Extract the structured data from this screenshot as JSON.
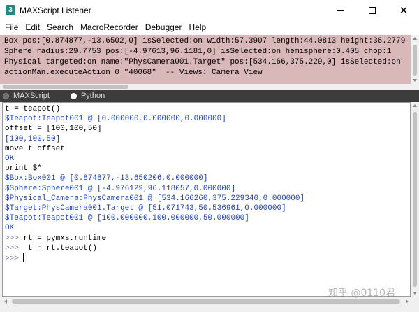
{
  "window": {
    "title": "MAXScript Listener",
    "icon_glyph": "3",
    "controls": {
      "minimize": "minimize-icon",
      "maximize": "maximize-icon",
      "close_glyph": "✕"
    }
  },
  "menu": [
    "File",
    "Edit",
    "Search",
    "MacroRecorder",
    "Debugger",
    "Help"
  ],
  "macro_recorder": {
    "lines": [
      "Box pos:[0.874877,-13.6502,0] isSelected:on width:57.3907 length:44.0813 height:36.2779",
      "Sphere radius:29.7753 pos:[-4.97613,96.1181,0] isSelected:on hemisphere:0.405 chop:1",
      "Physical targeted:on name:\"PhysCamera001.Target\" pos:[534.166,375.229,0] isSelected:on",
      "actionMan.executeAction 0 \"40068\"  -- Views: Camera View"
    ]
  },
  "tabs": [
    {
      "label": "MAXScript",
      "selected": false
    },
    {
      "label": "Python",
      "selected": true
    }
  ],
  "listener": {
    "colors": {
      "input": "#000000",
      "result": "#1a3fbf",
      "prompt": "#7a7ab0"
    },
    "lines": [
      {
        "kind": "input",
        "text": "t = teapot()"
      },
      {
        "kind": "result",
        "text": "$Teapot:Teapot001 @ [0.000000,0.000000,0.000000]"
      },
      {
        "kind": "input",
        "text": "offset = [100,100,50]"
      },
      {
        "kind": "result",
        "text": "[100,100,50]"
      },
      {
        "kind": "input",
        "text": "move t offset"
      },
      {
        "kind": "result",
        "text": "OK"
      },
      {
        "kind": "input",
        "text": "print $*"
      },
      {
        "kind": "result",
        "text": "$Box:Box001 @ [0.874877,-13.650206,0.000000]"
      },
      {
        "kind": "result",
        "text": "$Sphere:Sphere001 @ [-4.976129,96.118057,0.000000]"
      },
      {
        "kind": "result",
        "text": "$Physical_Camera:PhysCamera001 @ [534.166260,375.229340,0.000000]"
      },
      {
        "kind": "result",
        "text": "$Target:PhysCamera001.Target @ [51.071743,50.536961,0.000000]"
      },
      {
        "kind": "result",
        "text": "$Teapot:Teapot001 @ [100.000000,100.000000,50.000000]"
      },
      {
        "kind": "result",
        "text": "OK"
      },
      {
        "kind": "prompt",
        "prompt": ">>> ",
        "text": "rt = pymxs.runtime"
      },
      {
        "kind": "prompt",
        "prompt": ">>> ",
        "text": " t = rt.teapot()"
      },
      {
        "kind": "prompt",
        "prompt": ">>> ",
        "text": "",
        "cursor": true
      }
    ]
  },
  "watermark": "知乎 @0110君"
}
